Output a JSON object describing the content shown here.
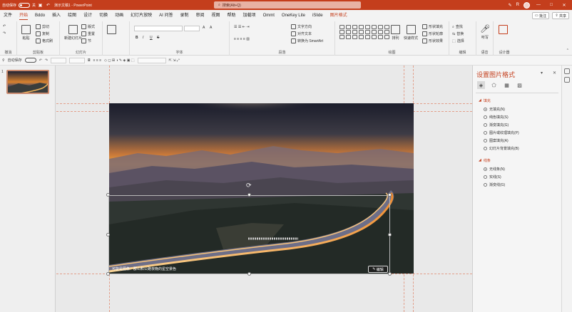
{
  "titlebar": {
    "autosave_label": "自动保存",
    "autosave_state": "关",
    "doc_title": "演示文稿1 - PowerPoint",
    "search_placeholder": "搜索(Alt+Q)",
    "user_initial": "R",
    "window_controls": [
      "—",
      "□",
      "✕"
    ]
  },
  "tabs": [
    "文件",
    "开始",
    "Bddo",
    "插入",
    "绘图",
    "设计",
    "切换",
    "动画",
    "幻灯片放映",
    "AI 问答",
    "录制",
    "审阅",
    "视图",
    "帮助",
    "加载项",
    "Ommt",
    "OneKey Lite",
    "iSlide",
    "图片格式"
  ],
  "active_tab_index": 1,
  "context_tab_index": 18,
  "share_label": "共享",
  "comments_label": "批注",
  "ribbon": {
    "clipboard": {
      "paste": "粘贴",
      "cut": "剪切",
      "copy": "复制",
      "format_painter": "格式刷",
      "label": "剪贴板"
    },
    "slides": {
      "new_slide": "新建幻灯片",
      "layout": "版式",
      "reset": "重置",
      "section": "节",
      "label": "幻灯片"
    },
    "font": {
      "label": "字体",
      "bold": "B",
      "italic": "I",
      "underline": "U",
      "strike": "S",
      "grow": "A",
      "shrink": "A"
    },
    "paragraph": {
      "label": "段落",
      "text_direction": "文字方向",
      "align_text": "对齐文本",
      "smartart": "转换为 SmartArt"
    },
    "drawing": {
      "arrange": "排列",
      "quick_styles": "快速样式",
      "shape_fill": "形状填充",
      "shape_outline": "形状轮廓",
      "shape_effects": "形状效果",
      "label": "绘图"
    },
    "editing": {
      "find": "查找",
      "replace": "替换",
      "select": "选择",
      "label": "编辑"
    },
    "voice": {
      "dictate": "听写",
      "label": "语音"
    },
    "designer": {
      "label": "设计器"
    }
  },
  "qat": {
    "autosave": "自动保存",
    "items": [
      "撤消",
      "恢复",
      "开始放映",
      "打开",
      "保存"
    ]
  },
  "slides_panel": {
    "slide_number": "1"
  },
  "canvas": {
    "alt_text": "可能是图像：群山和公路夜晚的星空景色",
    "edit_alt_label": "编辑"
  },
  "pane": {
    "title": "设置图片格式",
    "fill_section": "填充",
    "fill_options": [
      "无填充(N)",
      "纯色填充(S)",
      "渐变填充(G)",
      "图片或纹理填充(P)",
      "图案填充(A)",
      "幻灯片背景填充(B)"
    ],
    "fill_selected": 0,
    "line_section": "线条",
    "line_options": [
      "无线条(N)",
      "实线(S)",
      "渐变线(G)"
    ],
    "line_selected": 0
  },
  "colors": {
    "accent": "#c43e1c",
    "titlebar": "#c43e1c"
  }
}
